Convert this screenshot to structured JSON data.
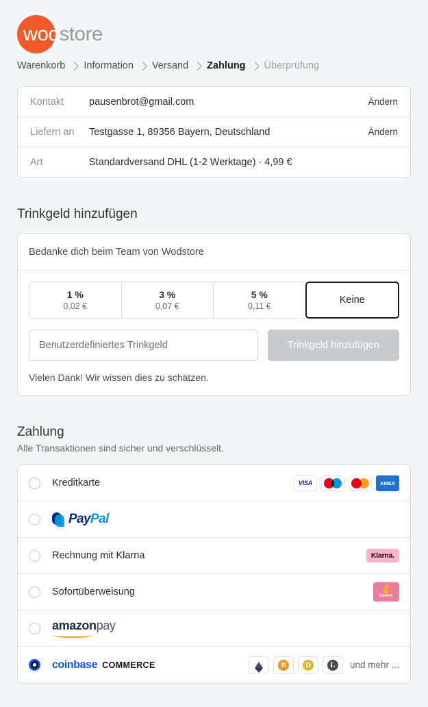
{
  "brand": {
    "name_part1": "wod",
    "name_part2": "store",
    "accent_color": "#f15a2b"
  },
  "breadcrumb": {
    "items": [
      {
        "label": "Warenkorb",
        "state": "link"
      },
      {
        "label": "Information",
        "state": "link"
      },
      {
        "label": "Versand",
        "state": "link"
      },
      {
        "label": "Zahlung",
        "state": "current"
      },
      {
        "label": "Überprüfung",
        "state": "disabled"
      }
    ]
  },
  "summary": {
    "rows": [
      {
        "label": "Kontakt",
        "value": "pausenbrot@gmail.com",
        "action": "Ändern"
      },
      {
        "label": "Liefern an",
        "value": "Testgasse 1, 89356 Bayern, Deutschland",
        "action": "Ändern"
      },
      {
        "label": "Art",
        "value": "Standardversand DHL (1-2 Werktage) · 4,99 €",
        "action": ""
      }
    ]
  },
  "tip": {
    "heading": "Trinkgeld hinzufügen",
    "prompt": "Bedanke dich beim Team von Wodstore",
    "options": [
      {
        "percent": "1 %",
        "amount": "0,02 €",
        "selected": false
      },
      {
        "percent": "3 %",
        "amount": "0,07 €",
        "selected": false
      },
      {
        "percent": "5 %",
        "amount": "0,11 €",
        "selected": false
      },
      {
        "percent": "Keine",
        "amount": "",
        "selected": true
      }
    ],
    "custom_placeholder": "Benutzerdefiniertes Trinkgeld",
    "custom_value": "",
    "add_button": "Trinkgeld hinzufügen",
    "add_button_disabled": true,
    "thanks": "Vielen Dank! Wir wissen dies zu schätzen."
  },
  "payment": {
    "heading": "Zahlung",
    "subheading": "Alle Transaktionen sind sicher und verschlüsselt.",
    "methods": [
      {
        "id": "kreditkarte",
        "label": "Kreditkarte",
        "selected": false,
        "brands": [
          "visa",
          "maestro",
          "mastercard",
          "amex"
        ]
      },
      {
        "id": "paypal",
        "label": "",
        "logo_text_a": "Pay",
        "logo_text_b": "Pal",
        "selected": false
      },
      {
        "id": "klarna",
        "label": "Rechnung mit Klarna",
        "badge": "Klarna.",
        "badge_color": "#ffb3c7",
        "selected": false
      },
      {
        "id": "sofort",
        "label": "Sofortüberweisung",
        "badge": "Sofort.",
        "badge_color": "#ee7a9b",
        "selected": false
      },
      {
        "id": "amazonpay",
        "label": "",
        "logo_text_a": "amazon",
        "logo_text_b": "pay",
        "selected": false
      },
      {
        "id": "coinbase",
        "label": "",
        "logo_text_a": "coinbase",
        "logo_text_b": "COMMERCE",
        "selected": true,
        "coins": [
          "ethereum",
          "bitcoin",
          "dogecoin",
          "litecoin"
        ],
        "more_label": "und mehr ..."
      }
    ]
  }
}
